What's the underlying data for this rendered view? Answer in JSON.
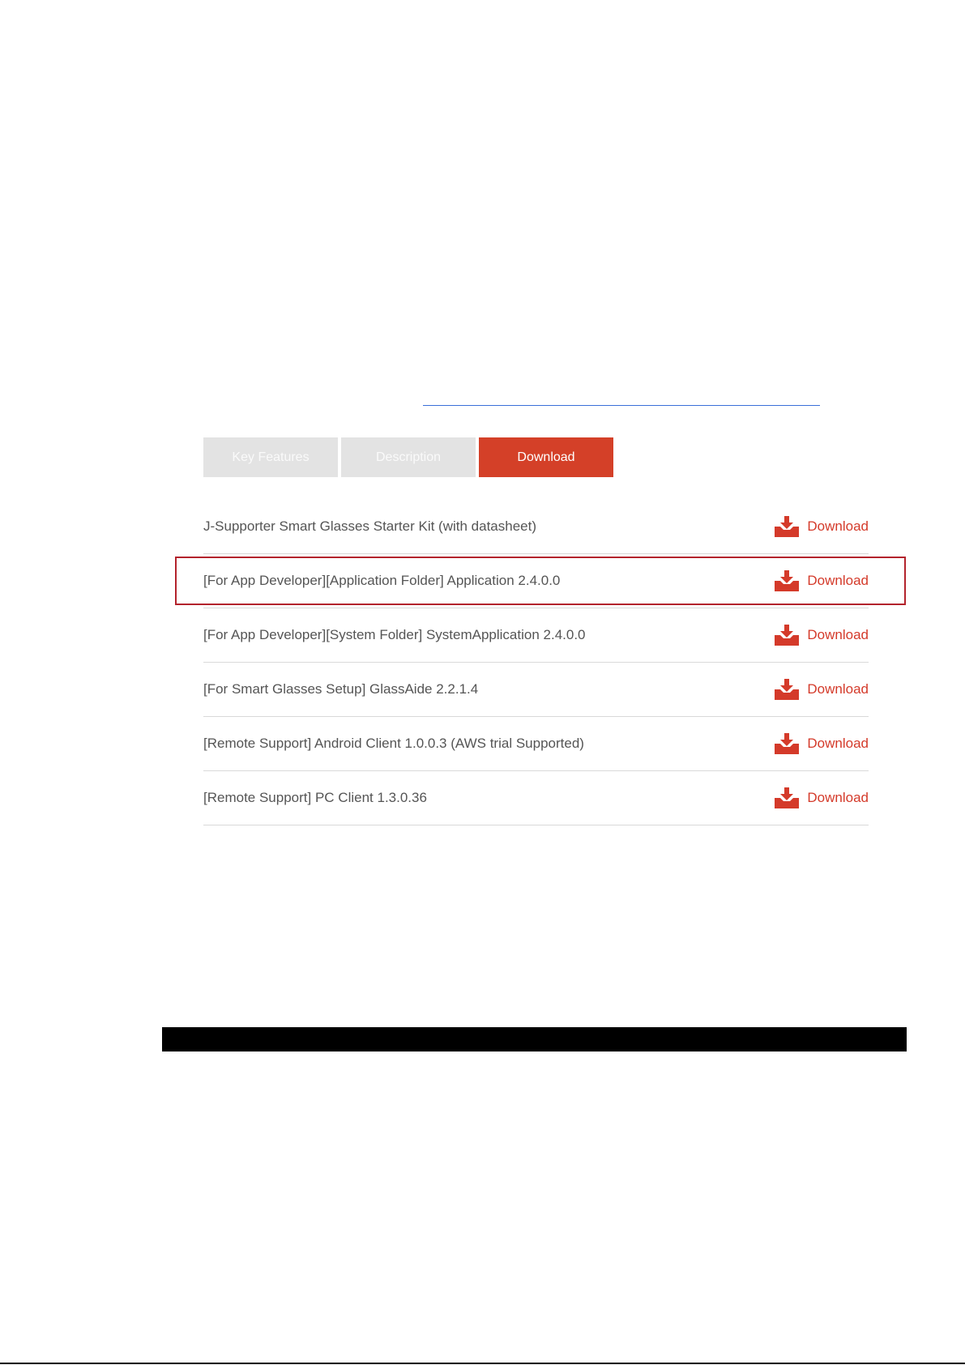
{
  "tabs": [
    {
      "label": "Key Features",
      "active": false
    },
    {
      "label": "Description",
      "active": false
    },
    {
      "label": "Download",
      "active": true
    }
  ],
  "downloads": [
    {
      "label": "J-Supporter Smart Glasses Starter Kit (with datasheet)",
      "link": "Download"
    },
    {
      "label": "[For App Developer][Application Folder] Application 2.4.0.0",
      "link": "Download"
    },
    {
      "label": "[For App Developer][System Folder] SystemApplication 2.4.0.0",
      "link": "Download"
    },
    {
      "label": "[For Smart Glasses Setup] GlassAide 2.2.1.4",
      "link": "Download"
    },
    {
      "label": "[Remote Support] Android Client 1.0.0.3 (AWS trial Supported)",
      "link": "Download"
    },
    {
      "label": "[Remote Support] PC Client 1.3.0.36",
      "link": "Download"
    }
  ],
  "icons": {
    "download": "download-tray-icon"
  },
  "colors": {
    "accent": "#d44028",
    "link_text": "#d43a2a",
    "highlight": "#b3232c",
    "tab_inactive": "#e3e3e3"
  }
}
